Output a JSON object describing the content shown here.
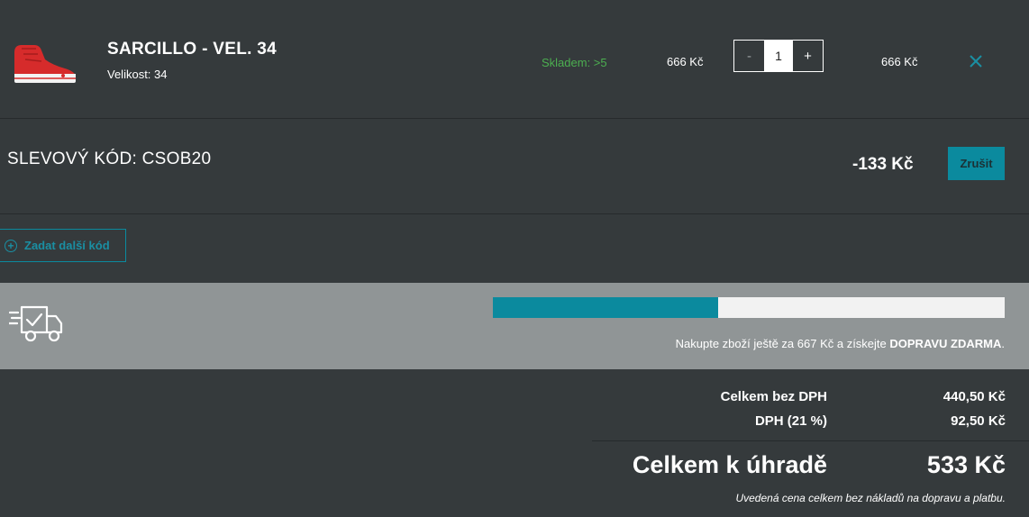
{
  "product": {
    "name": "SARCILLO - VEL. 34",
    "size_label": "Velikost: 34",
    "stock": "Skladem: >5",
    "unit_price": "666 Kč",
    "quantity": "1",
    "qty_minus": "-",
    "qty_plus": "+",
    "line_price": "666 Kč",
    "remove_icon": "close-icon",
    "stock_color": "#4caf50"
  },
  "discount": {
    "label": "SLEVOVÝ KÓD: CSOB20",
    "amount": "-133 Kč",
    "cancel_label": "Zrušit"
  },
  "add_code": {
    "label": "Zadat další kód"
  },
  "shipping": {
    "progress_fraction": 0.44,
    "text_prefix": "Nakupte zboží ještě za 667 Kč a získejte ",
    "text_bold": "DOPRAVU ZDARMA",
    "text_suffix": "."
  },
  "totals": {
    "without_vat_label": "Celkem bez DPH",
    "without_vat_value": "440,50 Kč",
    "vat_label": "DPH (21 %)",
    "vat_value": "92,50 Kč",
    "grand_label": "Celkem k úhradě",
    "grand_value": "533 Kč",
    "note": "Uvedená cena celkem bez nákladů na dopravu a platbu."
  },
  "colors": {
    "background": "#353a3c",
    "accent": "#0b8a9e",
    "shipping_band": "#909596"
  }
}
